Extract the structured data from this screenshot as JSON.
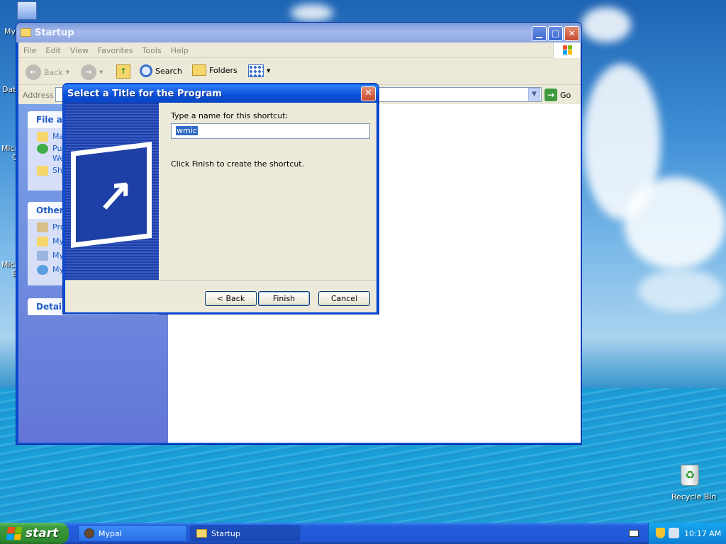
{
  "desktop": {
    "left_labels": [
      "My",
      "Dat",
      "Micro",
      "C",
      "Micro",
      "B"
    ],
    "recycle_bin": "Recycle Bin"
  },
  "explorer": {
    "title": "Startup",
    "menu": [
      "File",
      "Edit",
      "View",
      "Favorites",
      "Tools",
      "Help"
    ],
    "toolbar": {
      "back": "Back",
      "search": "Search",
      "folders": "Folders"
    },
    "address_label": "Address",
    "go_label": "Go",
    "panels": {
      "file_tasks": "File an",
      "file_items": [
        "Ma",
        "Pu",
        "We",
        "Sh"
      ],
      "other_places": "Other",
      "other_items": [
        "Pro",
        "My",
        "My",
        "My"
      ],
      "details": "Details"
    }
  },
  "dialog": {
    "title": "Select a Title for the Program",
    "prompt": "Type a name for this shortcut:",
    "input_value": "wmic",
    "note": "Click Finish to create the shortcut.",
    "back_label": "< Back",
    "finish_label": "Finish",
    "cancel_label": "Cancel"
  },
  "taskbar": {
    "start_label": "start",
    "tasks": [
      "Mypal",
      "Startup"
    ],
    "clock": "10:17 AM"
  },
  "colors": {
    "xp_blue": "#0a4bd3",
    "dialog_face": "#ece9d8",
    "start_green": "#3c9b3c",
    "selection": "#316ac5"
  }
}
